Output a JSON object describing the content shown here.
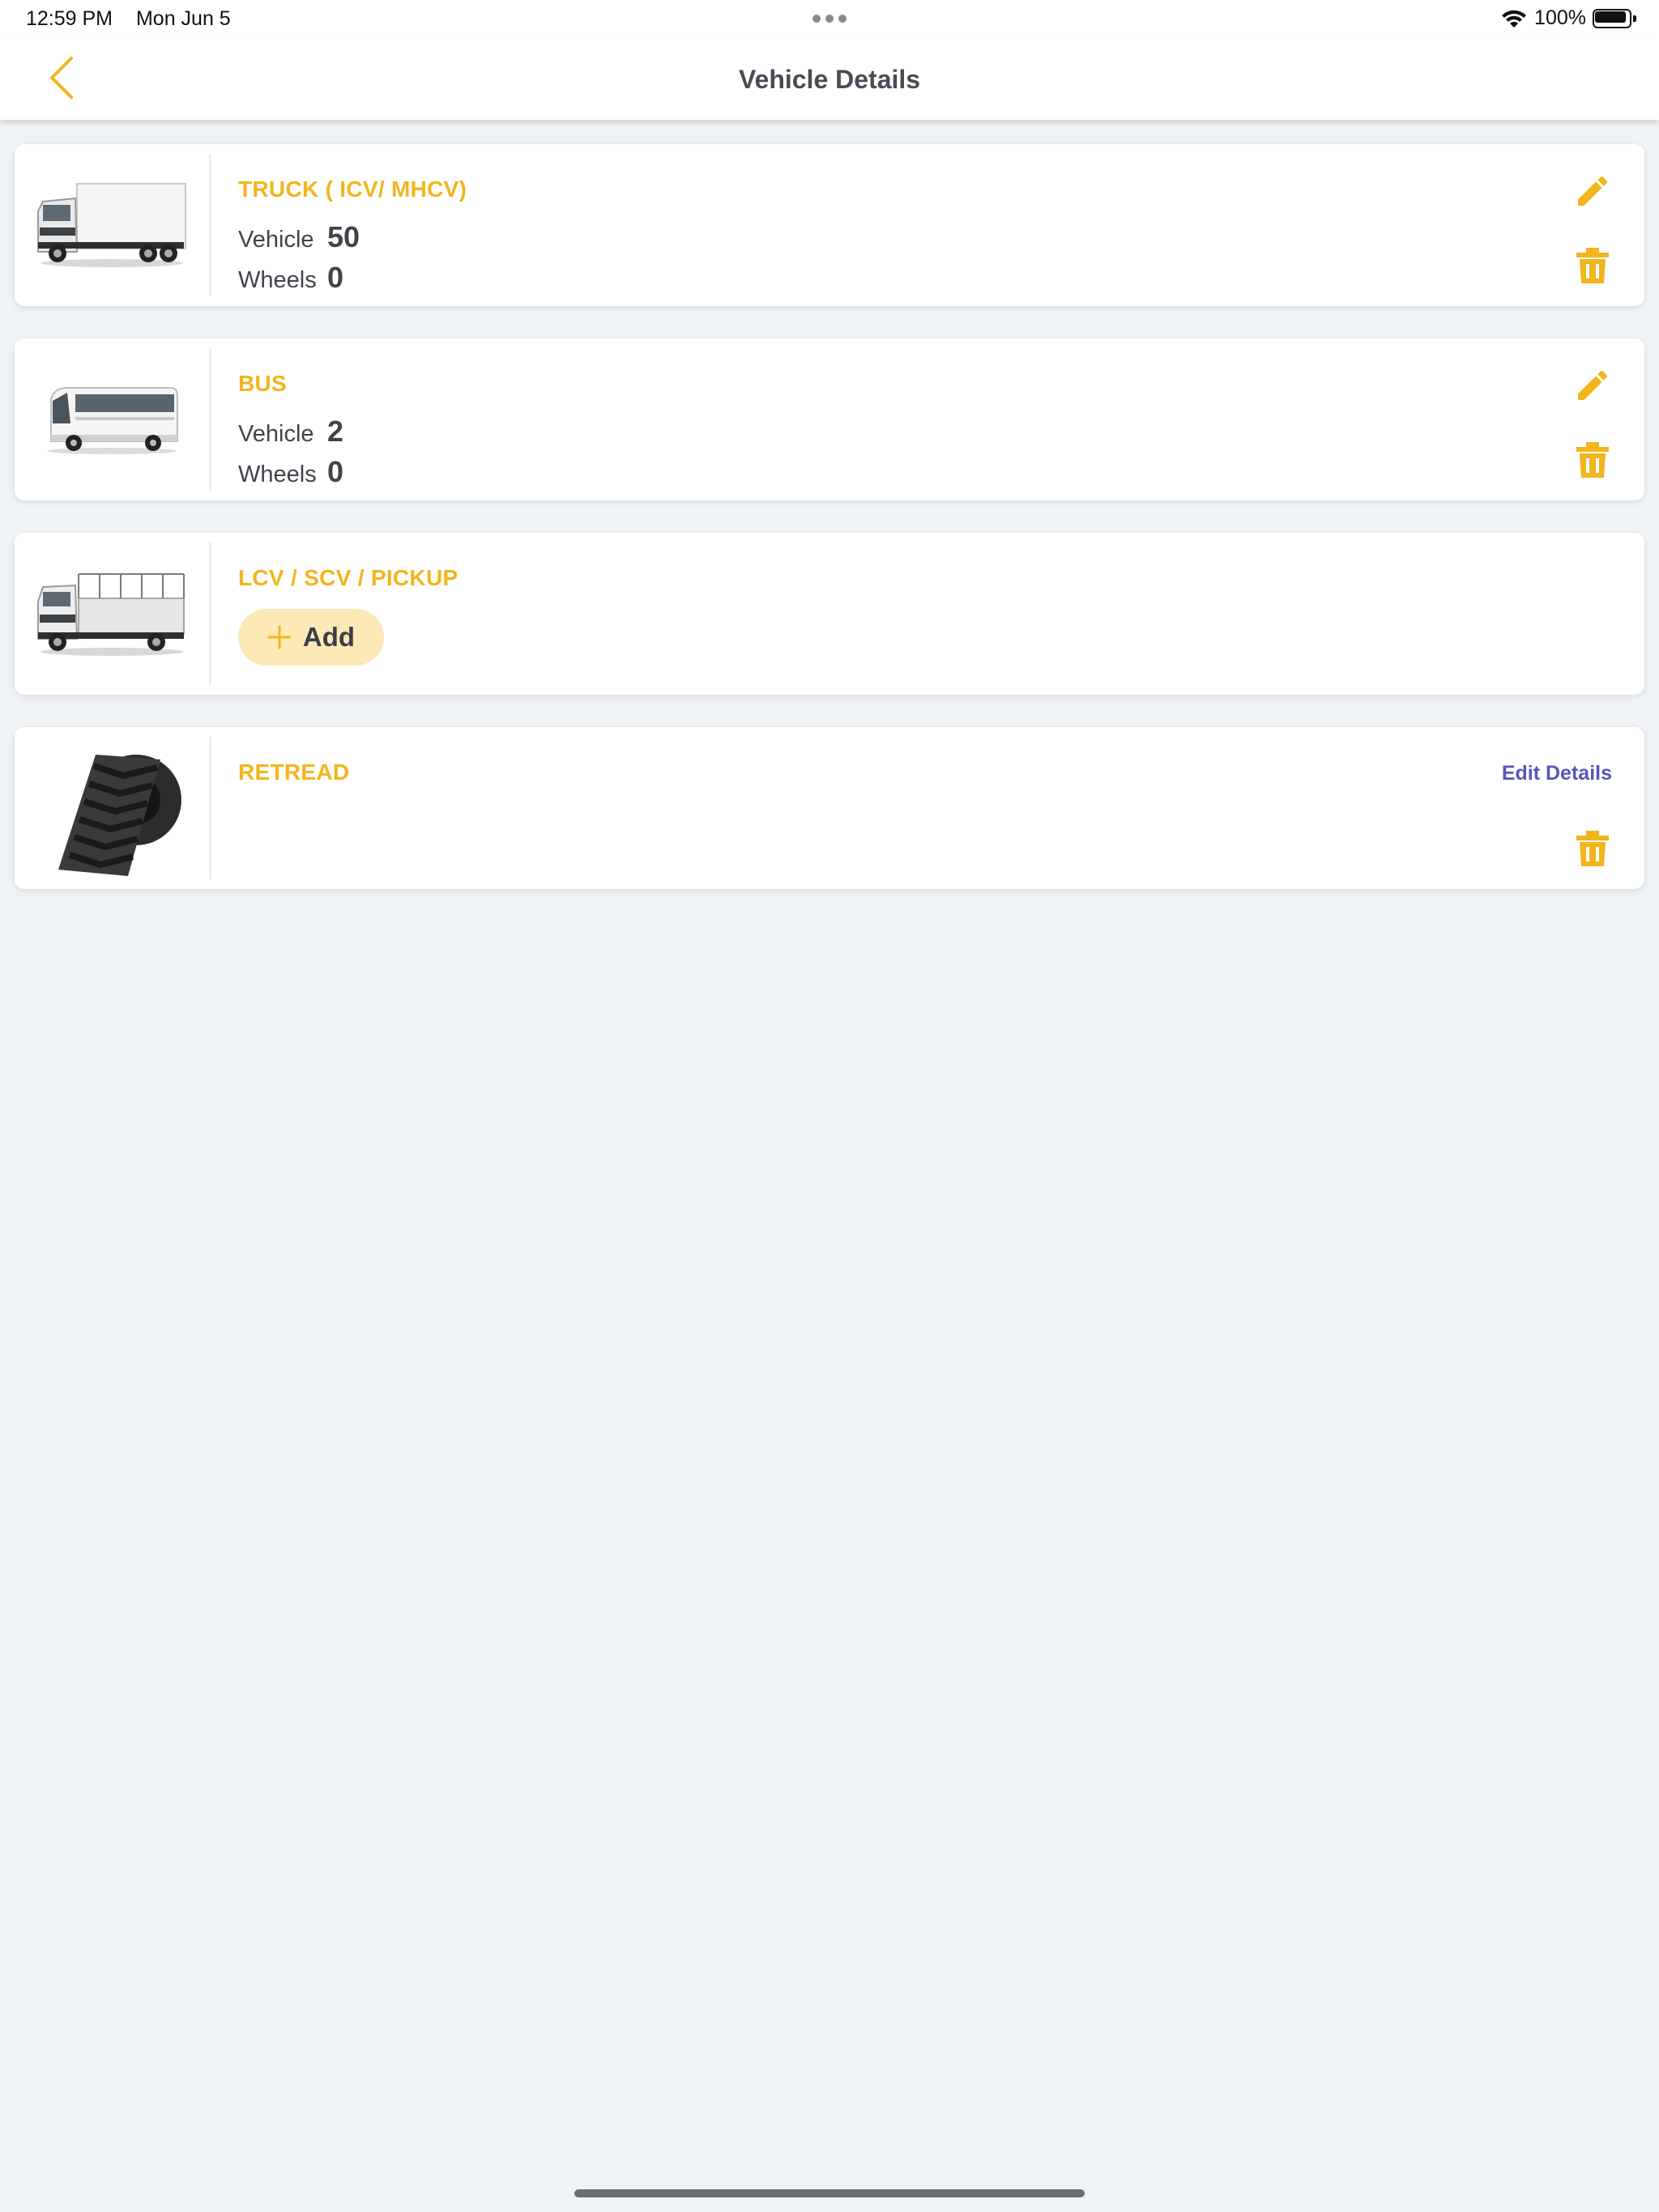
{
  "status_bar": {
    "time": "12:59 PM",
    "date": "Mon Jun 5",
    "battery": "100%"
  },
  "nav": {
    "title": "Vehicle Details"
  },
  "cards": [
    {
      "title": "TRUCK ( ICV/ MHCV)",
      "vehicle_label": "Vehicle",
      "vehicle_value": "50",
      "wheels_label": "Wheels",
      "wheels_value": "0",
      "image_icon": "truck-image"
    },
    {
      "title": "BUS",
      "vehicle_label": "Vehicle",
      "vehicle_value": "2",
      "wheels_label": "Wheels",
      "wheels_value": "0",
      "image_icon": "bus-image"
    },
    {
      "title": "LCV / SCV / PICKUP",
      "add_label": "Add",
      "image_icon": "pickup-truck-image"
    },
    {
      "title": "RETREAD",
      "edit_details_label": "Edit Details",
      "image_icon": "tread-rubber-image"
    }
  ],
  "colors": {
    "accent": "#f2b51c",
    "add_bg": "#fde9b6",
    "link": "#5457b8",
    "background": "#eff3f6"
  }
}
